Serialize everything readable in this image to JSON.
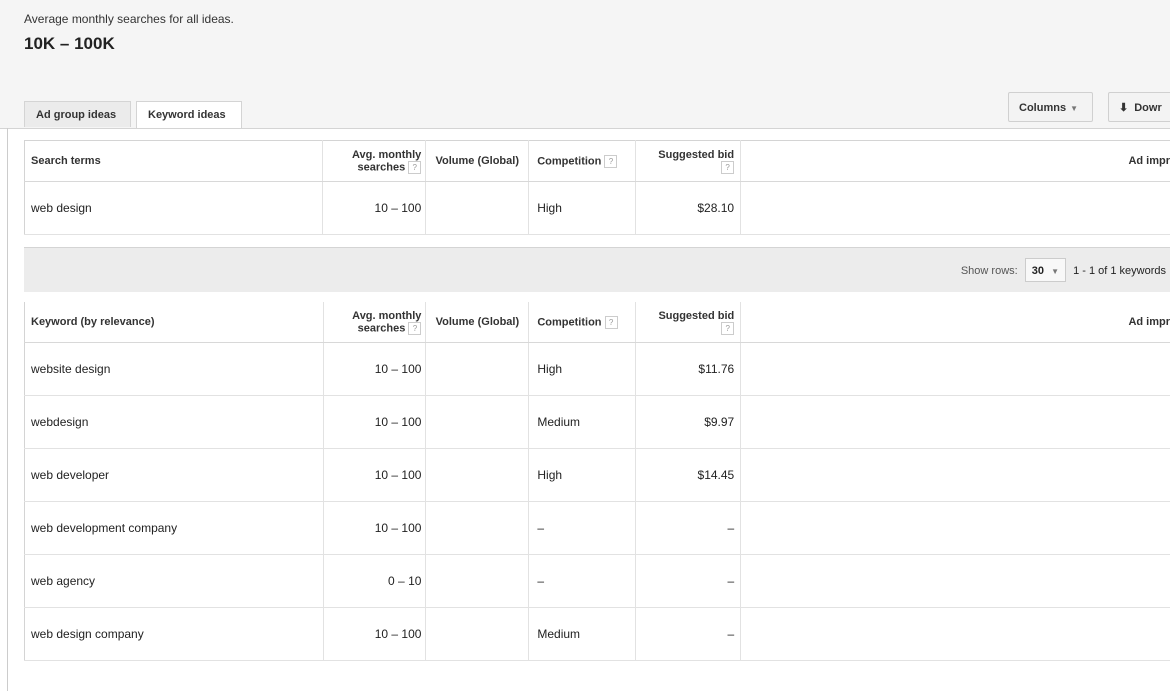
{
  "summary": {
    "label": "Average monthly searches for all ideas.",
    "value": "10K – 100K"
  },
  "tabs": [
    {
      "label": "Ad group ideas",
      "active": false
    },
    {
      "label": "Keyword ideas",
      "active": true
    }
  ],
  "toolbar": {
    "columns_label": "Columns",
    "download_label": "Dowr"
  },
  "columns": {
    "avg_line1": "Avg. monthly",
    "avg_line2": "searches",
    "volume": "Volume (Global)",
    "competition": "Competition",
    "bid": "Suggested bid",
    "ad_impr": "Ad impr",
    "help": "?"
  },
  "search_table": {
    "header": "Search terms",
    "rows": [
      {
        "term": "web design",
        "avg": "10 – 100",
        "volume": "",
        "competition": "High",
        "bid": "$28.10"
      }
    ]
  },
  "pager": {
    "show_rows_label": "Show rows:",
    "rows_value": "30",
    "range": "1 - 1 of 1 keywords"
  },
  "keyword_table": {
    "header": "Keyword (by relevance)",
    "rows": [
      {
        "term": "website design",
        "avg": "10 – 100",
        "volume": "",
        "competition": "High",
        "bid": "$11.76"
      },
      {
        "term": "webdesign",
        "avg": "10 – 100",
        "volume": "",
        "competition": "Medium",
        "bid": "$9.97"
      },
      {
        "term": "web developer",
        "avg": "10 – 100",
        "volume": "",
        "competition": "High",
        "bid": "$14.45"
      },
      {
        "term": "web development company",
        "avg": "10 – 100",
        "volume": "",
        "competition": "–",
        "bid": "–"
      },
      {
        "term": "web agency",
        "avg": "0 – 10",
        "volume": "",
        "competition": "–",
        "bid": "–"
      },
      {
        "term": "web design company",
        "avg": "10 – 100",
        "volume": "",
        "competition": "Medium",
        "bid": "–"
      }
    ]
  }
}
